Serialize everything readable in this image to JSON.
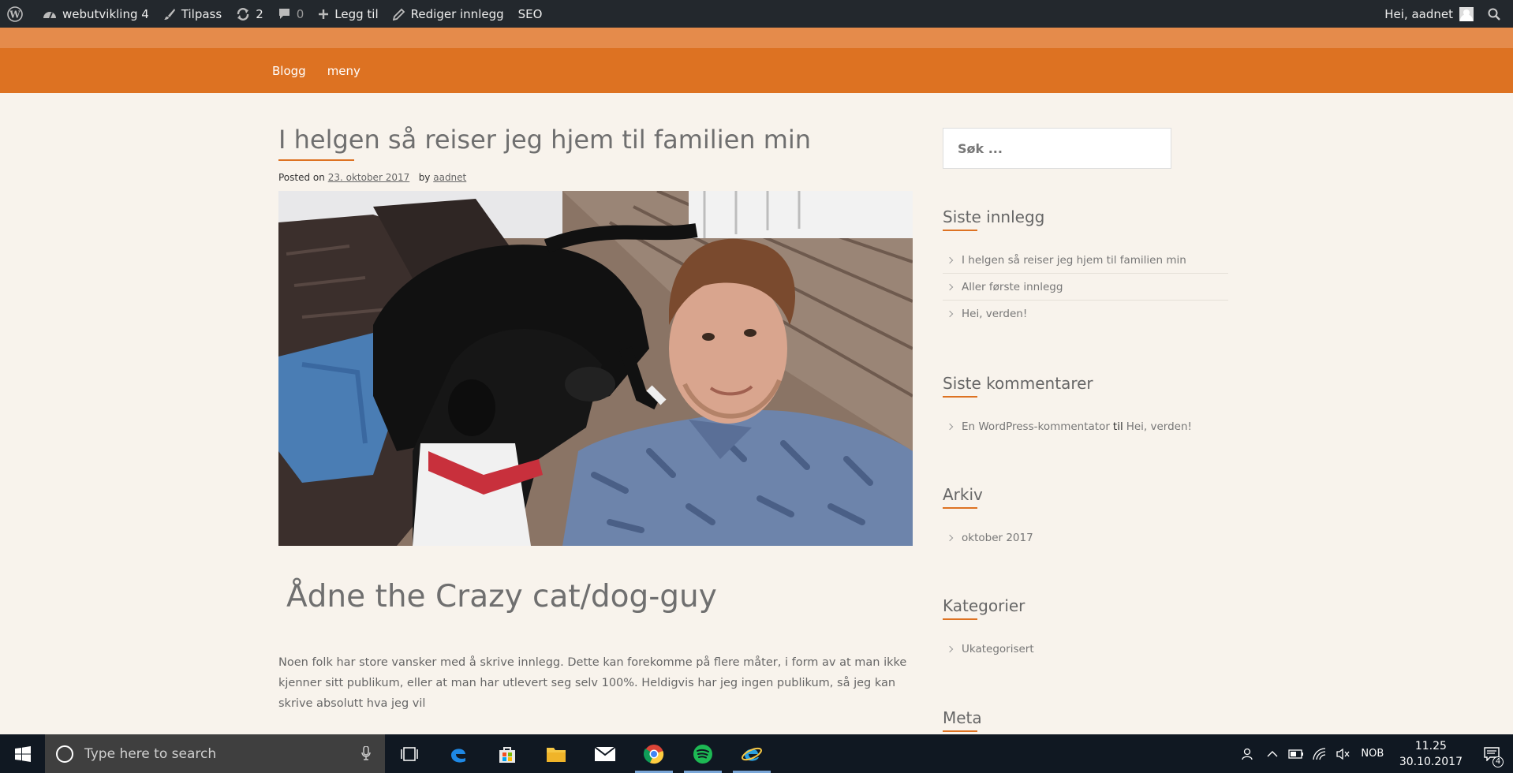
{
  "adminbar": {
    "site_name": "webutvikling 4",
    "customize": "Tilpass",
    "updates_count": "2",
    "comments_count": "0",
    "add_new": "Legg til",
    "edit_post": "Rediger innlegg",
    "seo": "SEO",
    "greeting": "Hei, aadnet"
  },
  "nav": {
    "items": [
      {
        "label": "Blogg"
      },
      {
        "label": "meny"
      }
    ]
  },
  "post": {
    "title": "I helgen så reiser jeg hjem til familien min",
    "posted_on": "Posted on",
    "date": "23. oktober 2017",
    "by": "by",
    "author": "aadnet",
    "heading": "Ådne the Crazy cat/dog-guy",
    "paragraph": "Noen folk har store vansker med å skrive innlegg. Dette kan forekomme på flere måter, i form  av at man ikke kjenner sitt publikum, eller at man har utlevert seg selv 100%. Heldigvis har jeg ingen publikum, så jeg kan skrive absolutt hva jeg vil"
  },
  "sidebar": {
    "search_placeholder": "Søk ...",
    "recent_posts": {
      "title": "Siste innlegg",
      "items": [
        {
          "label": "I helgen så reiser jeg hjem til familien min"
        },
        {
          "label": "Aller første innlegg"
        },
        {
          "label": "Hei, verden!"
        }
      ]
    },
    "recent_comments": {
      "title": "Siste kommentarer",
      "author": "En WordPress-kommentator",
      "connector": "til",
      "post": "Hei, verden!"
    },
    "archive": {
      "title": "Arkiv",
      "items": [
        {
          "label": "oktober 2017"
        }
      ]
    },
    "categories": {
      "title": "Kategorier",
      "items": [
        {
          "label": "Ukategorisert"
        }
      ]
    },
    "meta": {
      "title": "Meta"
    }
  },
  "taskbar": {
    "search_placeholder": "Type here to search",
    "language": "NOB",
    "time": "11.25",
    "date": "30.10.2017",
    "notifications": "4"
  },
  "colors": {
    "accent": "#dd7222",
    "accent_light": "#e58b4b",
    "admin_bar": "#23282d",
    "page_bg": "#f8f3ec"
  }
}
